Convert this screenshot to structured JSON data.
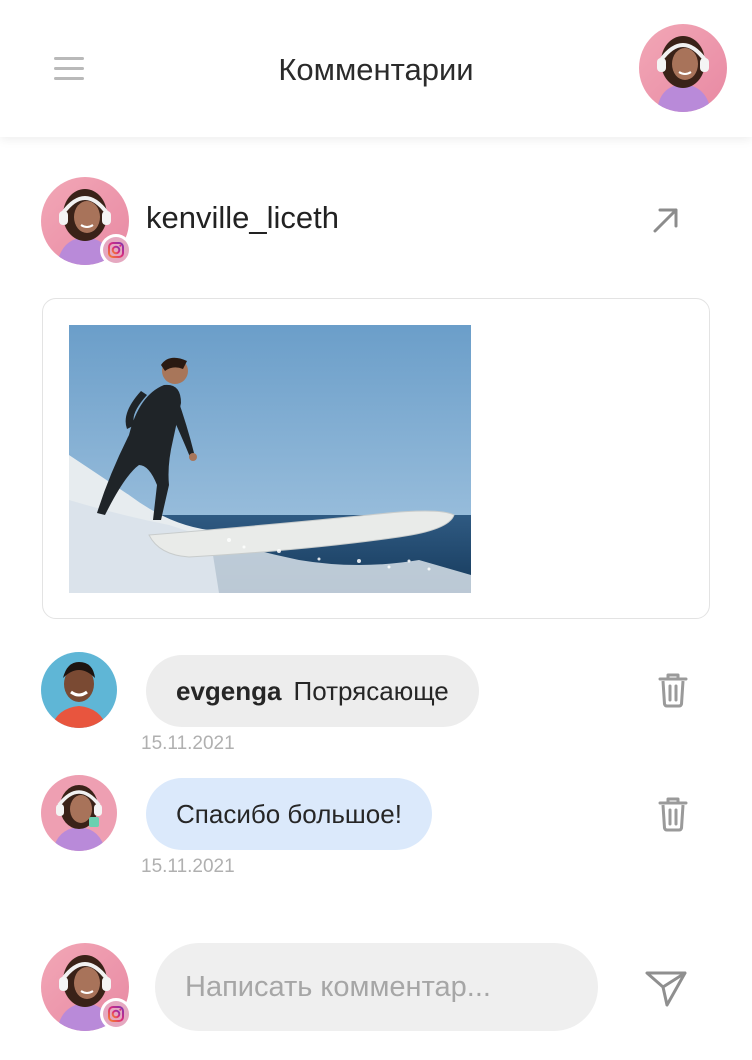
{
  "header": {
    "title": "Комментарии",
    "menu_icon": "hamburger-menu-icon",
    "avatar_icon": "user-avatar"
  },
  "post": {
    "author": "kenville_liceth",
    "source_icon": "instagram-icon",
    "open_icon": "arrow-up-right-icon",
    "image": "surfer-photo"
  },
  "comments": [
    {
      "author": "evgenga",
      "text": "Потрясающе",
      "date": "15.11.2021",
      "style": "grey",
      "delete_icon": "trash-icon"
    },
    {
      "author": "",
      "text": "Спасибо большое!",
      "date": "15.11.2021",
      "style": "blue",
      "delete_icon": "trash-icon"
    }
  ],
  "composer": {
    "placeholder": "Написать комментар...",
    "value": "",
    "send_icon": "send-icon"
  },
  "colors": {
    "accent_blue_bubble": "#dbe9fb",
    "grey_bubble": "#ededed",
    "icon_grey": "#9a9a9a",
    "instagram_gradient_start": "#f58529",
    "instagram_gradient_end": "#dd2a7b"
  }
}
